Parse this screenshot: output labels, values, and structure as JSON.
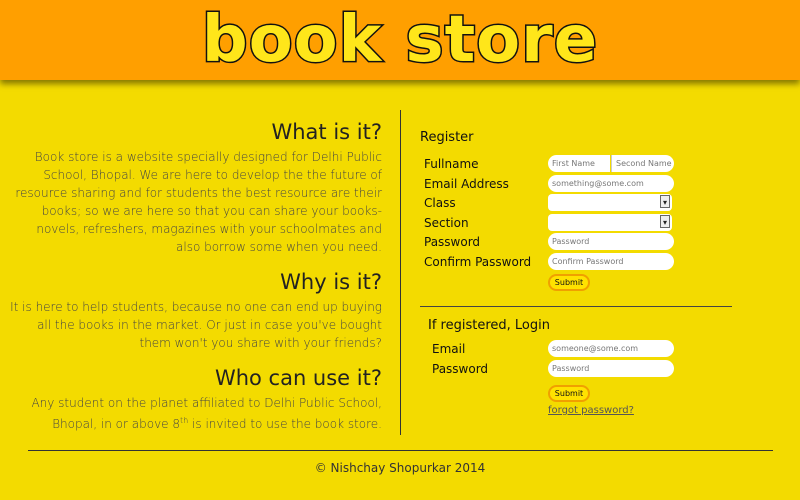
{
  "header": {
    "logo_text": "book store"
  },
  "about": {
    "what_title": "What is it?",
    "what_text": "Book store is a website specially designed for Delhi Public School, Bhopal. We are here to develop the the future of resource sharing and for students the best resource are their books; so we are here so that you can share your books- novels, refreshers, magazines with your schoolmates and also borrow some when you need.",
    "why_title": "Why is it?",
    "why_text": "It is here to help students, because no one can end up buying all the books in the market. Or just in case you've bought them won't you share with your friends?",
    "who_title": "Who can use it?",
    "who_text_before": "Any student on the planet affiliated to Delhi Public School, Bhopal, in or above 8",
    "who_text_sup": "th",
    "who_text_after": " is invited to use the book store."
  },
  "register": {
    "title": "Register",
    "fullname_label": "Fullname",
    "first_name_placeholder": "First Name",
    "second_name_placeholder": "Second Name",
    "email_label": "Email Address",
    "email_placeholder": "something@some.com",
    "class_label": "Class",
    "class_value": "",
    "section_label": "Section",
    "section_value": "",
    "password_label": "Password",
    "password_placeholder": "Password",
    "confirm_label": "Confirm Password",
    "confirm_placeholder": "Confirm Password",
    "submit_label": "Submit"
  },
  "login": {
    "title": "If registered, Login",
    "email_label": "Email",
    "email_placeholder": "someone@some.com",
    "password_label": "Password",
    "password_placeholder": "Password",
    "submit_label": "Submit",
    "forgot_label": "forgot password?"
  },
  "footer": {
    "text": "© Nishchay Shopurkar 2014"
  },
  "colors": {
    "background": "#f3db00",
    "header": "#ff9f00",
    "logo_fill": "#ffe61a"
  }
}
